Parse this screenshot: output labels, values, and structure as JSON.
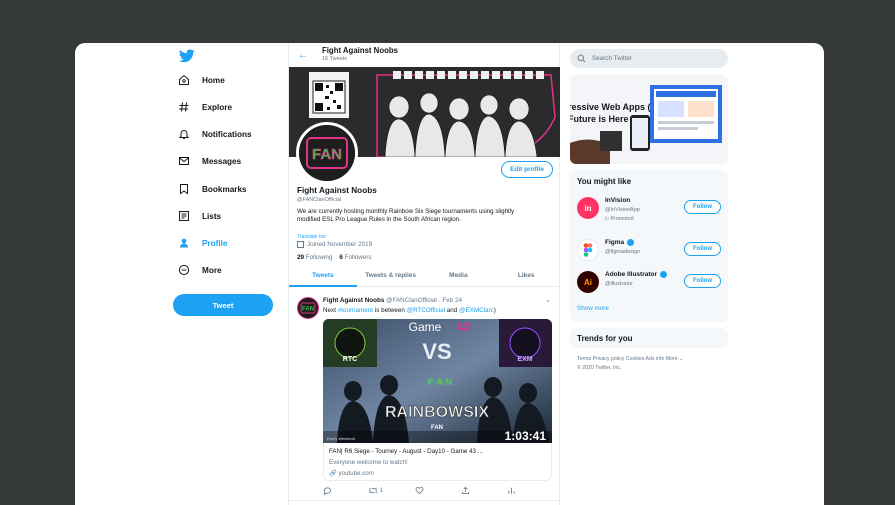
{
  "profile": {
    "header_name": "Fight Against Noobs",
    "tweet_count": "16 Tweets",
    "name": "Fight Against Noobs",
    "handle": "@FANClanOfficial",
    "bio": "We are currently hosting monthly Rainbow Six Siege tournaments using slightly modified ESL Pro League Rules in the South African region.",
    "translate": "Translate bio",
    "joined": "Joined November 2019",
    "following_count": "29",
    "following_label": "Following",
    "followers_count": "6",
    "followers_label": "Followers",
    "edit_label": "Edit profile",
    "avatar_text": "FAN"
  },
  "nav": {
    "items": [
      {
        "label": "Home",
        "icon": "home-icon"
      },
      {
        "label": "Explore",
        "icon": "hashtag-icon"
      },
      {
        "label": "Notifications",
        "icon": "bell-icon"
      },
      {
        "label": "Messages",
        "icon": "envelope-icon"
      },
      {
        "label": "Bookmarks",
        "icon": "bookmark-icon"
      },
      {
        "label": "Lists",
        "icon": "list-icon"
      },
      {
        "label": "Profile",
        "icon": "person-icon",
        "active": true
      },
      {
        "label": "More",
        "icon": "more-icon"
      }
    ],
    "tweet_button": "Tweet"
  },
  "tabs": [
    {
      "label": "Tweets",
      "active": true
    },
    {
      "label": "Tweets & replies"
    },
    {
      "label": "Media"
    },
    {
      "label": "Likes"
    }
  ],
  "tweet": {
    "author": "Fight Against Noobs",
    "handle_date": "@FANClanOfficial · Feb 24",
    "text_pre": "Next ",
    "hashtag": "#tournament",
    "text_mid": " is between ",
    "mention1": "@RTCOfficial",
    "text_and": " and ",
    "mention2": "@EXMClan",
    "text_post": ":)",
    "media": {
      "game": "Game",
      "game_num": "43",
      "vs": "VS",
      "team1": "RTC",
      "team2": "EXM",
      "brand": "F·A·N",
      "title": "RAINBOWSIX",
      "subtitle": "FAN",
      "time": "1:03:41",
      "corner": "Every Weekend"
    },
    "card_title": "FAN| R6 Siege - Tourney - August - Day10 - Game 43 ...",
    "card_desc": "Everyone welcome to watch!",
    "card_url": "youtube.com",
    "retweet_count": "1"
  },
  "search": {
    "placeholder": "Search Twitter"
  },
  "promo": {
    "line1": "ressive Web Apps (",
    "line2": "Future is Here"
  },
  "you_might_like": {
    "title": "You might like",
    "accounts": [
      {
        "name": "InVision",
        "handle": "@InVisionApp",
        "promoted": "Promoted",
        "follow": "Follow",
        "color": "#ff3366",
        "mark": "in"
      },
      {
        "name": "Figma",
        "handle": "@figmadesign",
        "follow": "Follow",
        "verified": true,
        "color": "#ffffff",
        "mark": "F"
      },
      {
        "name": "Adobe Illustrator",
        "handle": "@illustrator",
        "follow": "Follow",
        "verified": true,
        "color": "#330000",
        "mark": "Ai"
      }
    ],
    "show_more": "Show more"
  },
  "trends": {
    "title": "Trends for you"
  },
  "footer": {
    "links": "Terms  Privacy policy  Cookies  Ads info  More ⌄",
    "copyright": "© 2020 Twitter, Inc."
  },
  "colors": {
    "accent": "#1da1f2",
    "brand_pink": "#e0338a"
  }
}
